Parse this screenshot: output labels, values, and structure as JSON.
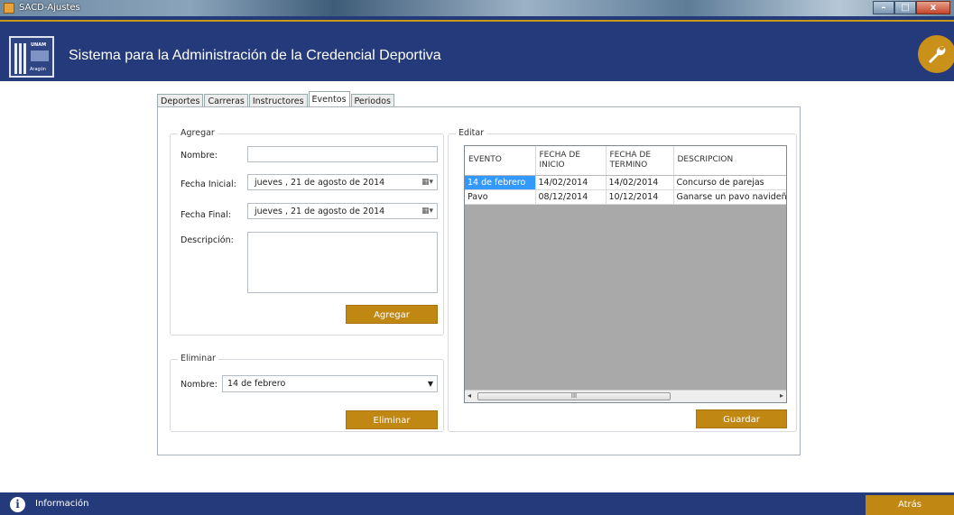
{
  "window": {
    "title": "SACD-Ajustes",
    "min": "–",
    "max": "□",
    "close": "x"
  },
  "header": {
    "app_title": "Sistema para la Administración de la Credencial Deportiva",
    "logo_text": "UNAM",
    "logo_subtext": "Aragón"
  },
  "tabs": [
    {
      "label": "Deportes",
      "active": false
    },
    {
      "label": "Carreras",
      "active": false
    },
    {
      "label": "Instructores",
      "active": false
    },
    {
      "label": "Eventos",
      "active": true
    },
    {
      "label": "Periodos",
      "active": false
    }
  ],
  "agregar": {
    "legend": "Agregar",
    "nombre_label": "Nombre:",
    "nombre_value": "",
    "fecha_inicial_label": "Fecha Inicial:",
    "fecha_inicial_value": "jueves   , 21 de    agosto    de 2014",
    "fecha_final_label": "Fecha Final:",
    "fecha_final_value": "jueves   , 21 de    agosto    de 2014",
    "descripcion_label": "Descripción:",
    "descripcion_value": "",
    "button": "Agregar"
  },
  "eliminar": {
    "legend": "Eliminar",
    "nombre_label": "Nombre:",
    "selected": "14 de febrero",
    "button": "Eliminar"
  },
  "editar": {
    "legend": "Editar",
    "columns": [
      "EVENTO",
      "FECHA DE INICIO",
      "FECHA DE TERMINO",
      "DESCRIPCION"
    ],
    "rows": [
      {
        "evento": "14 de febrero",
        "inicio": "14/02/2014",
        "termino": "14/02/2014",
        "descripcion": "Concurso de parejas",
        "selected": true
      },
      {
        "evento": "Pavo",
        "inicio": "08/12/2014",
        "termino": "10/12/2014",
        "descripcion": "Ganarse un pavo navideño",
        "selected": false
      }
    ],
    "scroll_grip": "III",
    "button": "Guardar"
  },
  "footer": {
    "info_icon": "i",
    "info_label": "Información",
    "back_label": "Atrás"
  },
  "colors": {
    "navy": "#253a7a",
    "gold": "#c08712",
    "selection": "#3399ff"
  }
}
